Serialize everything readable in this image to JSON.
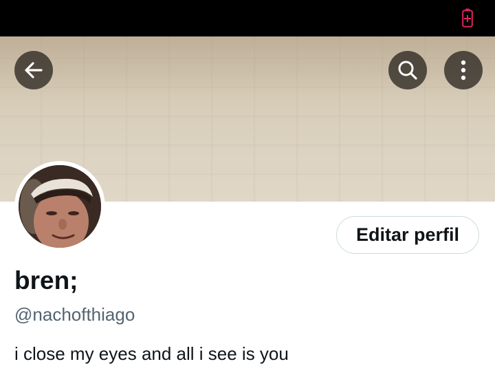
{
  "status_bar": {
    "battery_icon": "battery-charging-icon",
    "battery_color": "#e0245e"
  },
  "header": {
    "back_icon": "arrow-left-icon",
    "search_icon": "search-icon",
    "more_icon": "more-vertical-icon"
  },
  "profile": {
    "display_name": "bren;",
    "handle": "@nachofthiago",
    "bio": "i close my eyes and all i see is you",
    "edit_button_label": "Editar perfil"
  },
  "colors": {
    "text_primary": "#0f1419",
    "text_secondary": "#536471",
    "border": "#cfd9de"
  }
}
